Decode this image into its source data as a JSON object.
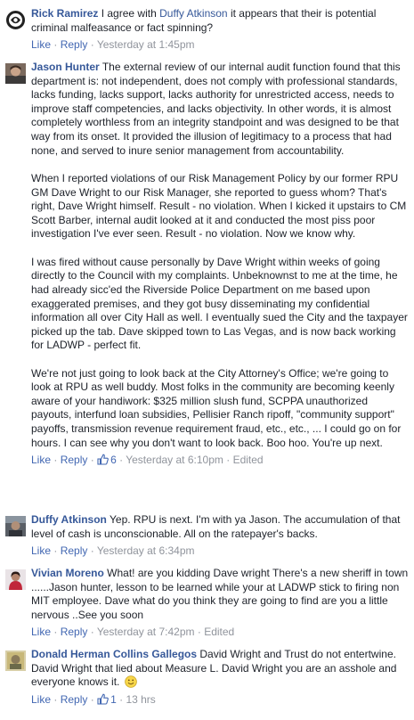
{
  "ui": {
    "like": "Like",
    "reply": "Reply",
    "dot": "·"
  },
  "comments": [
    {
      "author": "Rick Ramirez",
      "text_before": "I agree with",
      "mention": "Duffy Atkinson",
      "text_after": "it appears that their is potential criminal malfeasance or fact spinning?",
      "time": "Yesterday at 1:45pm"
    },
    {
      "author": "Jason Hunter",
      "paragraphs": [
        "The external review of our internal audit function found that this department is: not independent, does not comply with professional standards, lacks funding, lacks support, lacks authority for unrestricted access, needs to improve staff competencies, and lacks objectivity. In other words, it is almost completely worthless from an integrity standpoint and was designed to be that way from its onset. It provided the illusion of legitimacy to a process that had none, and served to inure senior management from accountability.",
        "When I reported violations of our Risk Management Policy by our former RPU GM Dave Wright to our Risk Manager, she reported to guess whom? That's right, Dave Wright himself. Result - no violation. When I kicked it upstairs to CM Scott Barber, internal audit looked at it and conducted the most piss poor investigation I've ever seen. Result - no violation. Now we know why.",
        "I was fired without cause personally by Dave Wright within weeks of going directly to the Council with my complaints. Unbeknownst to me at the time, he had already sicc'ed the Riverside Police Department on me based upon exaggerated premises, and they got busy disseminating my confidential information all over City Hall as well. I eventually sued the City and the taxpayer picked up the tab. Dave skipped town to Las Vegas, and is now back working for LADWP - perfect fit.",
        "We're not just going to look back at the City Attorney's Office; we're going to look at RPU as well buddy. Most folks in the community are becoming keenly aware of your handiwork: $325 million slush fund, SCPPA unauthorized payouts, interfund loan subsidies, Pellisier Ranch ripoff, \"community support\" payoffs, transmission revenue requirement fraud, etc., etc., ... I could go on for hours. I can see why you don't want to look back. Boo hoo. You're up next."
      ],
      "likes": "6",
      "time": "Yesterday at 6:10pm",
      "edited": "Edited"
    },
    {
      "author": "Duffy Atkinson",
      "text": "Yep. RPU is next. I'm with ya Jason. The accumulation of that level of cash is unconscionable. All on the ratepayer's backs.",
      "time": "Yesterday at 6:34pm"
    },
    {
      "author": "Vivian Moreno",
      "text": "What! are you kidding Dave wright There's a new sheriff in town ......Jason hunter, lesson to be learned while your at LADWP stick to firing non MIT employee. Dave what do you think they are going to find are you a little nervous ..See you soon",
      "time": "Yesterday at 7:42pm",
      "edited": "Edited"
    },
    {
      "author": "Donald Herman Collins Gallegos",
      "text": "David Wright and Trust do not entertwine. David Wright that lied about Measure L. David Wright you are an asshole and everyone knows it.",
      "emoji": "smile-emoji",
      "likes": "1",
      "time": "13 hrs"
    }
  ],
  "colors": {
    "link": "#365899",
    "action": "#4267b2",
    "meta": "#90949c",
    "text": "#1d2129"
  }
}
